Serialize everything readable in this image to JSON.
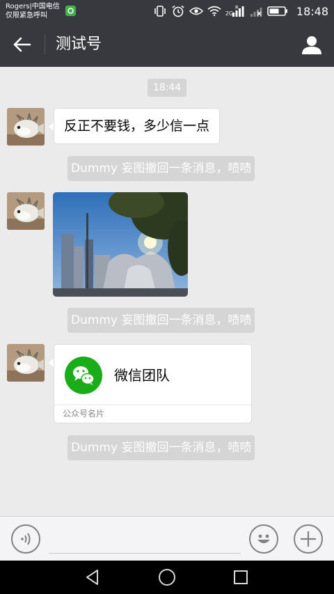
{
  "status_bar": {
    "carrier_line1": "Rogers|中国电信",
    "carrier_line2": "仅限紧急呼叫",
    "network_type": "2G",
    "time": "18:48"
  },
  "nav": {
    "title": "测试号",
    "background_color": "#37393e"
  },
  "chat": {
    "timestamp": "18:44",
    "messages": [
      {
        "type": "text",
        "text": "反正不要钱，多少信一点"
      },
      {
        "type": "system",
        "text": "Dummy 妄图撤回一条消息，啧啧"
      },
      {
        "type": "image"
      },
      {
        "type": "system",
        "text": "Dummy 妄图撤回一条消息，啧啧"
      },
      {
        "type": "card",
        "name": "微信团队",
        "footer": "公众号名片"
      },
      {
        "type": "system",
        "text": "Dummy 妄图撤回一条消息，啧啧"
      }
    ]
  },
  "input_bar": {
    "voice_icon": "voice-icon",
    "emoji_icon": "emoji-icon",
    "plus_icon": "plus-icon"
  },
  "colors": {
    "chat_background": "#ebebeb",
    "system_message_bg": "#d5d5d5",
    "wechat_green": "#1aad19"
  }
}
